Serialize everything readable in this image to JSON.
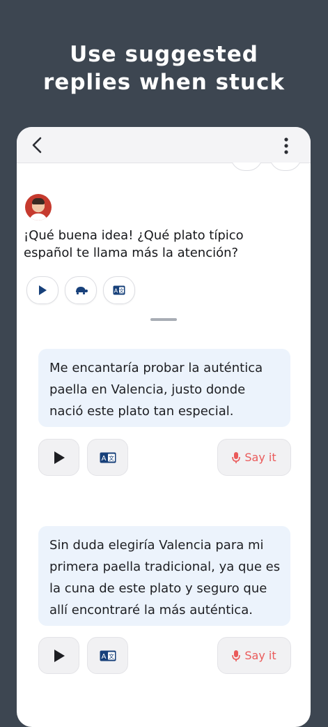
{
  "headline": {
    "line1": "Use suggested",
    "line2": "replies when stuck"
  },
  "topbar": {
    "back_icon": "chevron-left-icon",
    "menu_icon": "more-vertical-icon"
  },
  "message": {
    "line1": "¡Qué buena idea! ¿Qué plato típico",
    "line2": "español te llama más la atención?",
    "tools": [
      "play-icon",
      "turtle-slow-icon",
      "translate-icon"
    ]
  },
  "suggestions": [
    {
      "lines": [
        "Me encantaría probar la auténtica",
        "paella en Valencia, justo donde",
        "nació este plato tan especial."
      ],
      "say_it_label": "Say it"
    },
    {
      "lines": [
        "Sin duda elegiría Valencia para mi",
        "primera paella tradicional, ya que es",
        "la cuna de este plato y seguro que",
        "allí encontraré la más auténtica."
      ],
      "say_it_label": "Say it"
    }
  ],
  "colors": {
    "background": "#3d4651",
    "accent_blue": "#17407a",
    "say_it_red": "#ea5a5a",
    "bubble": "#ecf3fc"
  }
}
